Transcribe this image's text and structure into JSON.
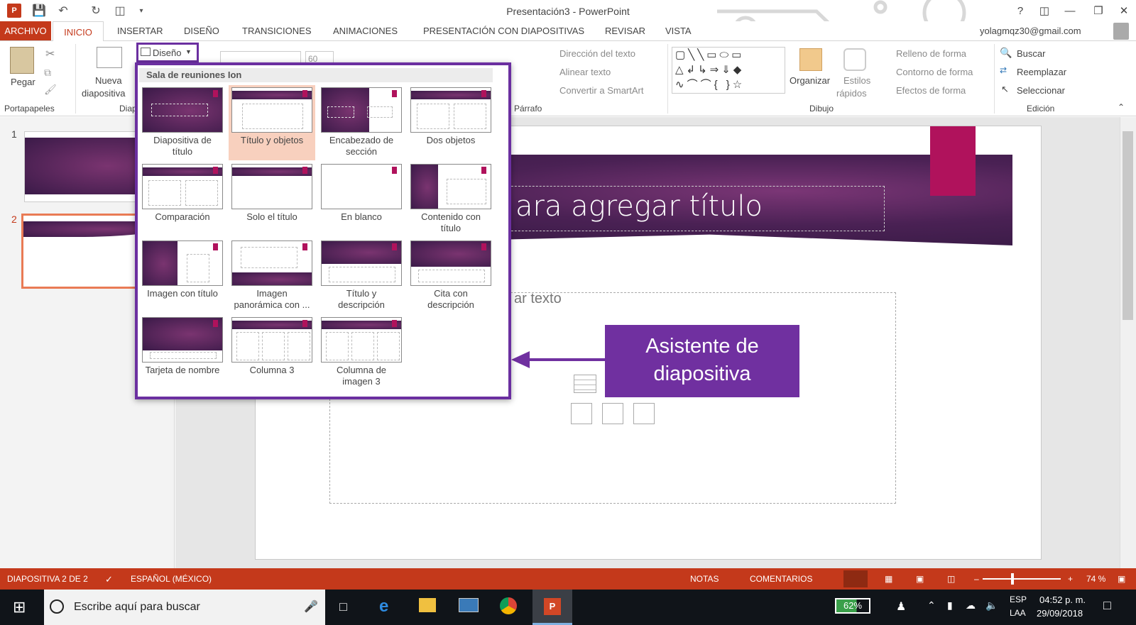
{
  "app": {
    "title": "Presentación3 - PowerPoint",
    "account": "yolagmqz30@gmail.com"
  },
  "tabs": [
    "ARCHIVO",
    "INICIO",
    "INSERTAR",
    "DISEÑO",
    "TRANSICIONES",
    "ANIMACIONES",
    "PRESENTACIÓN CON DIAPOSITIVAS",
    "REVISAR",
    "VISTA"
  ],
  "ribbon": {
    "paste": "Pegar",
    "new_slide": "Nueva",
    "new_slide2": "diapositiva",
    "layout_btn": "Diseño",
    "font_size": "60",
    "clipboard_group": "Portapapeles",
    "slides_group": "Diap",
    "paragraph_group": "Párrafo",
    "drawing_group": "Dibujo",
    "editing_group": "Edición",
    "text_direction": "Dirección del texto",
    "align_text": "Alinear texto",
    "smartart": "Convertir a SmartArt",
    "arrange": "Organizar",
    "quick_styles": "Estilos",
    "quick_styles2": "rápidos",
    "shape_fill": "Relleno de forma",
    "shape_outline": "Contorno de forma",
    "shape_effects": "Efectos de forma",
    "find": "Buscar",
    "replace": "Reemplazar",
    "select": "Seleccionar"
  },
  "gallery": {
    "header": "Sala de reuniones Ion",
    "layouts": [
      {
        "l1": "Diapositiva de",
        "l2": "título"
      },
      {
        "l1": "Título y objetos",
        "l2": ""
      },
      {
        "l1": "Encabezado de",
        "l2": "sección"
      },
      {
        "l1": "Dos objetos",
        "l2": ""
      },
      {
        "l1": "Comparación",
        "l2": ""
      },
      {
        "l1": "Solo el título",
        "l2": ""
      },
      {
        "l1": "En blanco",
        "l2": ""
      },
      {
        "l1": "Contenido con",
        "l2": "título"
      },
      {
        "l1": "Imagen con título",
        "l2": ""
      },
      {
        "l1": "Imagen",
        "l2": "panorámica con ..."
      },
      {
        "l1": "Título y",
        "l2": "descripción"
      },
      {
        "l1": "Cita con",
        "l2": "descripción"
      },
      {
        "l1": "Tarjeta de nombre",
        "l2": ""
      },
      {
        "l1": "Columna 3",
        "l2": ""
      },
      {
        "l1": "Columna de",
        "l2": "imagen 3"
      }
    ]
  },
  "slide": {
    "title_text": "ara agregar título",
    "body_text": "ar texto"
  },
  "thumbs": {
    "n1": "1",
    "n2": "2"
  },
  "callout": {
    "line1": "Asistente de",
    "line2": "diapositiva"
  },
  "status": {
    "slide": "DIAPOSITIVA 2 DE 2",
    "lang": "ESPAÑOL (MÉXICO)",
    "notes": "NOTAS",
    "comments": "COMENTARIOS",
    "zoom": "74 %"
  },
  "taskbar": {
    "search": "Escribe aquí para buscar",
    "battery": "62%",
    "lang1": "ESP",
    "lang2": "LAA",
    "time": "04:52 p. m.",
    "date": "29/09/2018"
  },
  "colors": {
    "accent": "#c4391b",
    "purple": "#7030a0",
    "magenta": "#b0125c"
  }
}
